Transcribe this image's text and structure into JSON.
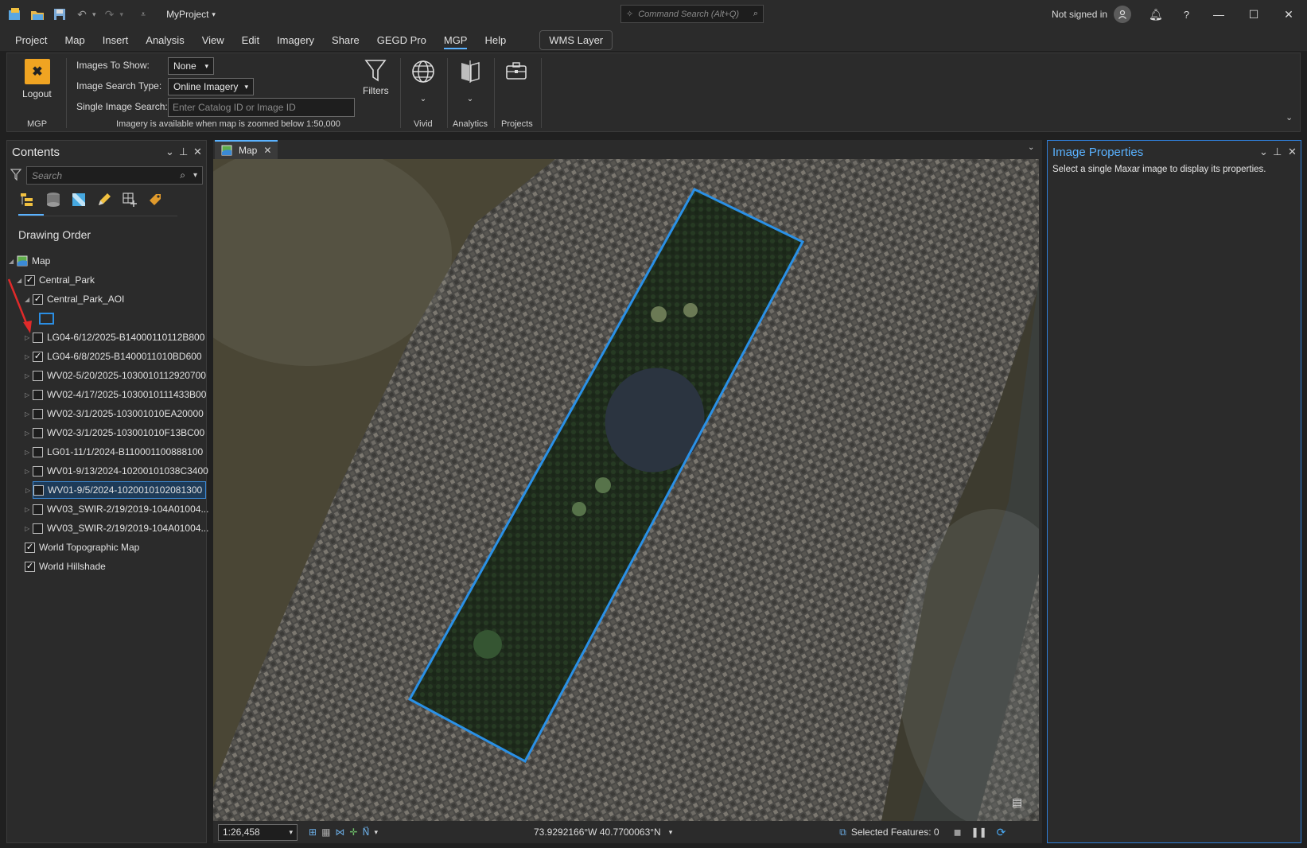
{
  "titlebar": {
    "project_name": "MyProject",
    "command_search_placeholder": "Command Search (Alt+Q)",
    "signin_text": "Not signed in"
  },
  "menu": {
    "items": [
      "Project",
      "Map",
      "Insert",
      "Analysis",
      "View",
      "Edit",
      "Imagery",
      "Share",
      "GEGD Pro",
      "MGP",
      "Help"
    ],
    "active": "MGP",
    "wms_button": "WMS Layer"
  },
  "ribbon": {
    "logout_label": "Logout",
    "group_mgp": "MGP",
    "images_to_show_label": "Images To Show:",
    "images_to_show_value": "None",
    "image_search_type_label": "Image Search Type:",
    "image_search_type_value": "Online Imagery",
    "single_image_search_label": "Single Image Search:",
    "single_image_search_placeholder": "Enter Catalog ID or Image ID",
    "zoom_note": "Imagery is available when map is zoomed below 1:50,000",
    "filters_label": "Filters",
    "vivid_label": "Vivid",
    "analytics_label": "Analytics",
    "projects_label": "Projects"
  },
  "contents": {
    "title": "Contents",
    "search_placeholder": "Search",
    "drawing_order": "Drawing Order",
    "map_node": "Map",
    "central_park": "Central_Park",
    "central_park_aoi": "Central_Park_AOI",
    "layers": [
      {
        "name": "LG04-6/12/2025-B14000110112B800",
        "checked": false
      },
      {
        "name": "LG04-6/8/2025-B1400011010BD600",
        "checked": true
      },
      {
        "name": "WV02-5/20/2025-1030010112920700",
        "checked": false
      },
      {
        "name": "WV02-4/17/2025-1030010111433B00",
        "checked": false
      },
      {
        "name": "WV02-3/1/2025-103001010EA20000",
        "checked": false
      },
      {
        "name": "WV02-3/1/2025-103001010F13BC00",
        "checked": false
      },
      {
        "name": "LG01-11/1/2024-B110001100888100",
        "checked": false
      },
      {
        "name": "WV01-9/13/2024-10200101038C3400",
        "checked": false
      },
      {
        "name": "WV01-9/5/2024-1020010102081300",
        "checked": false,
        "selected": true
      },
      {
        "name": "WV03_SWIR-2/19/2019-104A01004...",
        "checked": false
      },
      {
        "name": "WV03_SWIR-2/19/2019-104A01004...",
        "checked": false
      }
    ],
    "basemaps": [
      {
        "name": "World Topographic Map",
        "checked": true
      },
      {
        "name": "World Hillshade",
        "checked": true
      }
    ]
  },
  "map": {
    "tab_label": "Map",
    "scale": "1:26,458",
    "coordinates": "73.9292166°W 40.7700063°N",
    "selected_features": "Selected Features: 0"
  },
  "properties": {
    "title": "Image Properties",
    "message": "Select a single Maxar image to display its properties."
  }
}
